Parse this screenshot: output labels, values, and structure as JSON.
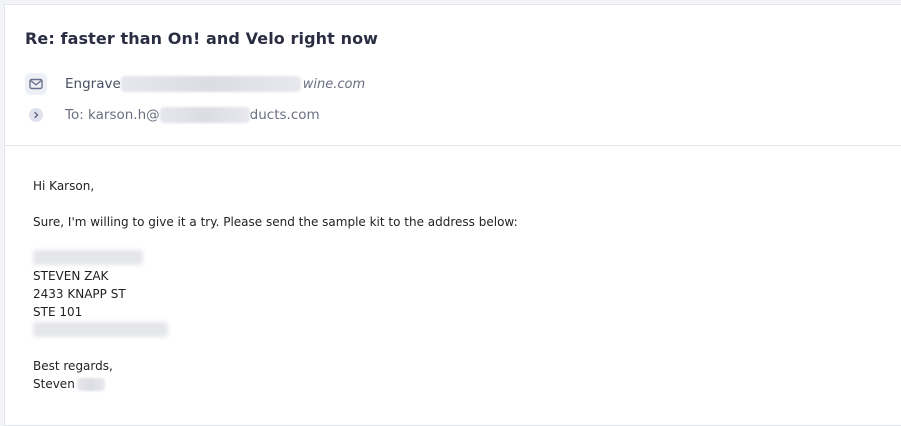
{
  "email": {
    "subject": "Re: faster than On! and Velo right now",
    "from": {
      "icon": "mail-icon",
      "prefix": "Engrave",
      "domain_tail": "wine.com"
    },
    "to": {
      "icon": "chevron-right-icon",
      "prefix": "To: karson.h@",
      "domain_tail": "ducts.com"
    },
    "body": {
      "greeting": "Hi Karson,",
      "line1": "Sure, I'm willing to give it a try. Please send the sample kit to the address below:",
      "address": {
        "name": "STEVEN ZAK",
        "street": "2433 KNAPP ST",
        "suite": "STE 101"
      },
      "signoff": "Best regards,",
      "signature": "Steven"
    }
  }
}
